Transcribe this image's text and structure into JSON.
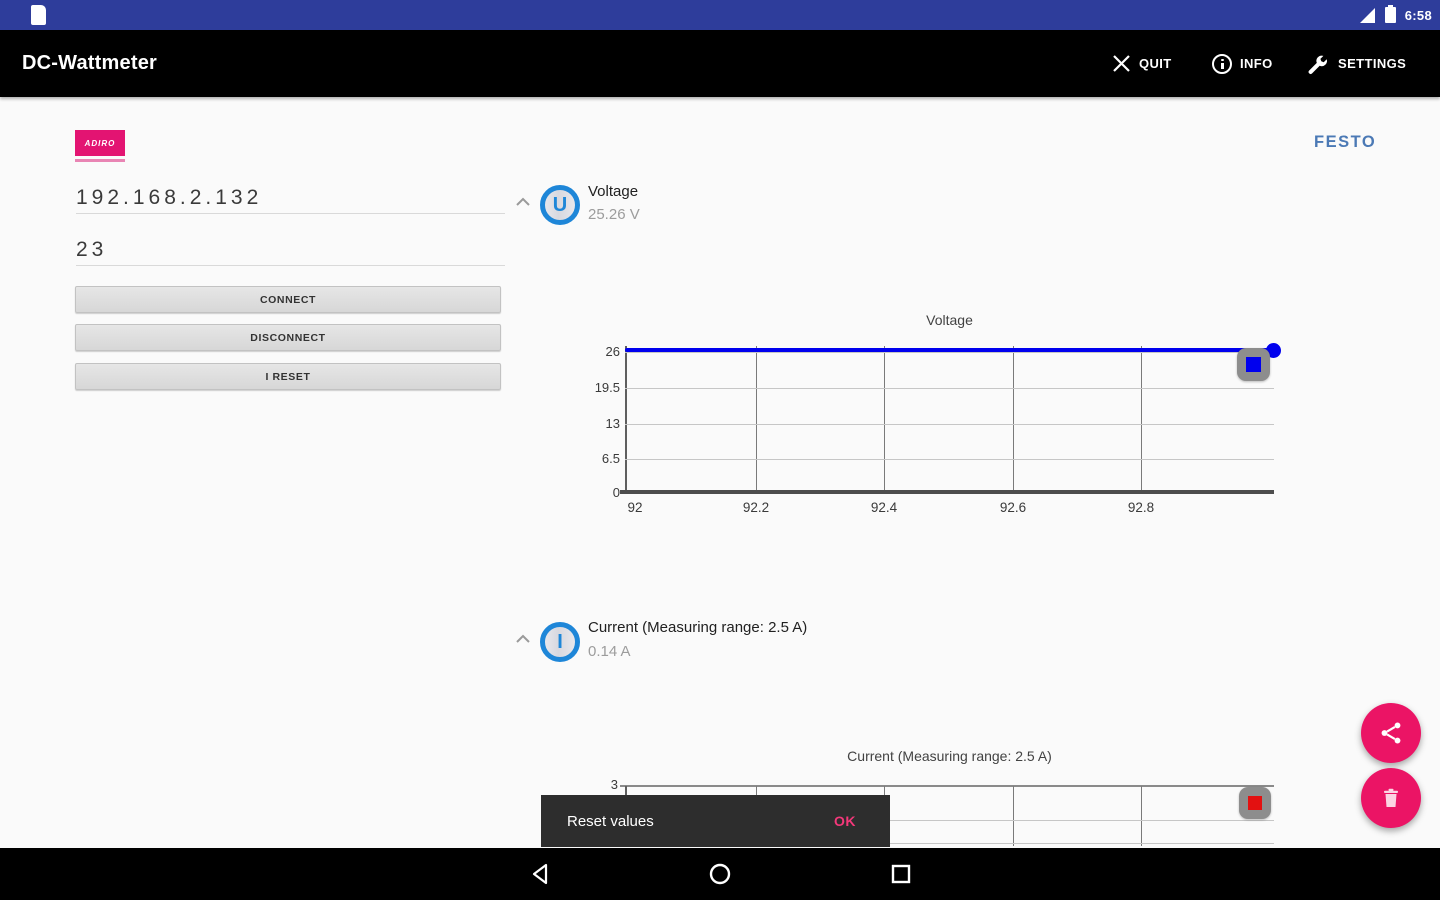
{
  "status_bar": {
    "time": "6:58"
  },
  "app_bar": {
    "title": "DC-Wattmeter",
    "actions": {
      "quit": "QUIT",
      "info": "INFO",
      "settings": "SETTINGS"
    }
  },
  "brand": {
    "partner_logo": "ADIRO",
    "festo": "FESTO"
  },
  "connection": {
    "ip": "192.168.2.132",
    "port": "23",
    "connect_label": "CONNECT",
    "disconnect_label": "DISCONNECT",
    "i_reset_label": "I RESET"
  },
  "voltage": {
    "symbol": "U",
    "label": "Voltage",
    "value": "25.26 V"
  },
  "current": {
    "symbol": "I",
    "label": "Current (Measuring range: 2.5 A)",
    "value": "0.14 A"
  },
  "chart_data": [
    {
      "type": "line",
      "title": "Voltage",
      "xlabel": "",
      "ylabel": "",
      "xlim": [
        92,
        93
      ],
      "ylim": [
        0,
        26
      ],
      "yticks": [
        "26",
        "19.5",
        "13",
        "6.5",
        "0"
      ],
      "xticks": [
        "92",
        "92.2",
        "92.4",
        "92.6",
        "92.8"
      ],
      "grid": true,
      "legend_position": "top-right",
      "series": [
        {
          "name": "Voltage",
          "color": "#0000ee",
          "x": [
            92,
            93
          ],
          "y": [
            25.26,
            25.26
          ]
        }
      ]
    },
    {
      "type": "line",
      "title": "Current (Measuring range: 2.5 A)",
      "xlabel": "",
      "ylabel": "",
      "ylim": [
        0,
        3
      ],
      "yticks": [
        "3"
      ],
      "xticks": [],
      "grid": true,
      "legend_position": "top-right",
      "series": [
        {
          "name": "Current",
          "color": "#e31111",
          "y": [
            0.14
          ]
        }
      ]
    }
  ],
  "snackbar": {
    "message": "Reset values",
    "action": "OK"
  },
  "colors": {
    "status_bar": "#2e3d9b",
    "accent_pink": "#eb1465",
    "festo_blue": "#4b79b5",
    "unit_icon_blue": "#1e86d8",
    "voltage_line": "#0000ee",
    "current_series": "#e31111"
  }
}
